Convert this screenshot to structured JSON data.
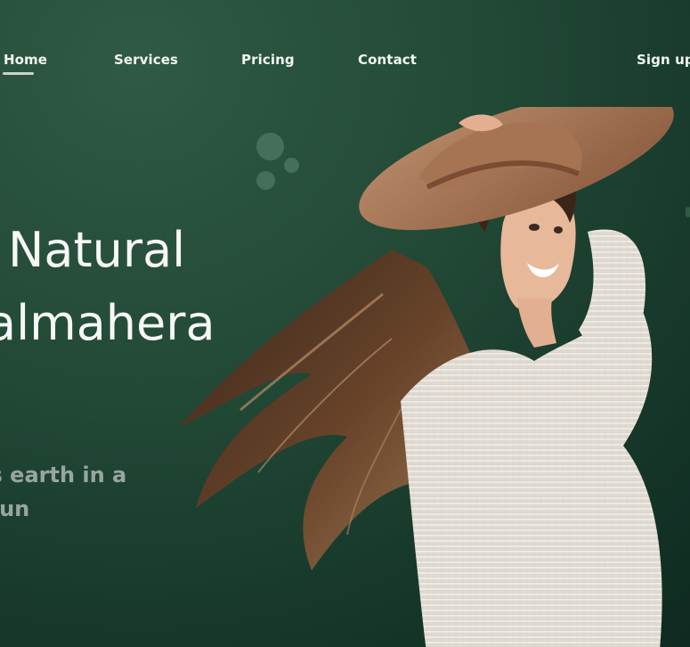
{
  "nav": {
    "items": [
      "Home",
      "Services",
      "Pricing",
      "Contact"
    ],
    "signup_label": "Sign up"
  },
  "hero": {
    "headline_line1": "Natural",
    "headline_line2": "lalmahera",
    "subtext_line1": "d's earth in a",
    "subtext_line2": "e fun"
  },
  "colors": {
    "background": "#234a37",
    "text": "#f6f7f6",
    "subtext": "#98a69f",
    "accent_bubble": "#4d7a66"
  }
}
